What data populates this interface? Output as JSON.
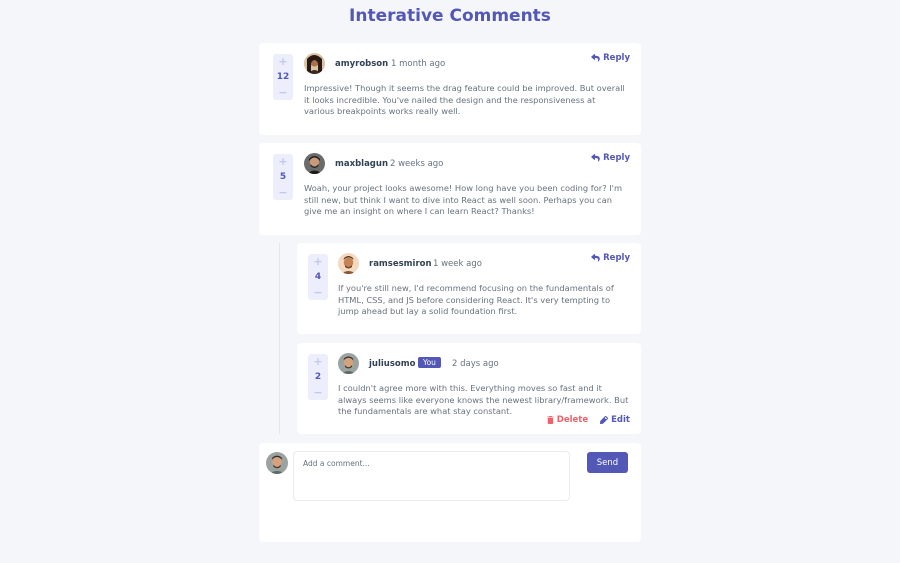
{
  "page": {
    "title": "Interative Comments"
  },
  "reply_label": "Reply",
  "comments": [
    {
      "score": "12",
      "username": "amyrobson",
      "created": "1 month ago",
      "content": "Impressive! Though it seems the drag feature could be improved. But overall it looks incredible. You've nailed the design and the responsiveness at various breakpoints works really well."
    },
    {
      "score": "5",
      "username": "maxblagun",
      "created": "2 weeks ago",
      "content": "Woah, your project looks awesome! How long have you been coding for? I'm still new, but think I want to dive into React as well soon. Perhaps you can give me an insight on where I can learn React? Thanks!"
    }
  ],
  "replies": [
    {
      "score": "4",
      "username": "ramsesmiron",
      "created": "1 week ago",
      "content": "If you're still new, I'd recommend focusing on the fundamentals of HTML, CSS, and JS before considering React. It's very tempting to jump ahead but lay a solid foundation first."
    },
    {
      "score": "2",
      "username": "juliusomo",
      "badge": "You",
      "created": "2 days ago",
      "content": "I couldn't agree more with this. Everything moves so fast and it always seems like everyone knows the newest library/framework. But the fundamentals are what stay constant.",
      "delete_label": "Delete",
      "edit_label": "Edit"
    }
  ],
  "compose": {
    "placeholder": "Add a comment...",
    "send_label": "Send"
  },
  "icons": {
    "upvote": "plus-icon",
    "downvote": "minus-icon",
    "reply": "reply-arrow-icon",
    "delete": "trash-icon",
    "edit": "pencil-icon"
  },
  "colors": {
    "accent": "#5357b6",
    "danger": "#ed6368",
    "background": "#f5f6fa",
    "vote_bg": "#eceefb"
  }
}
